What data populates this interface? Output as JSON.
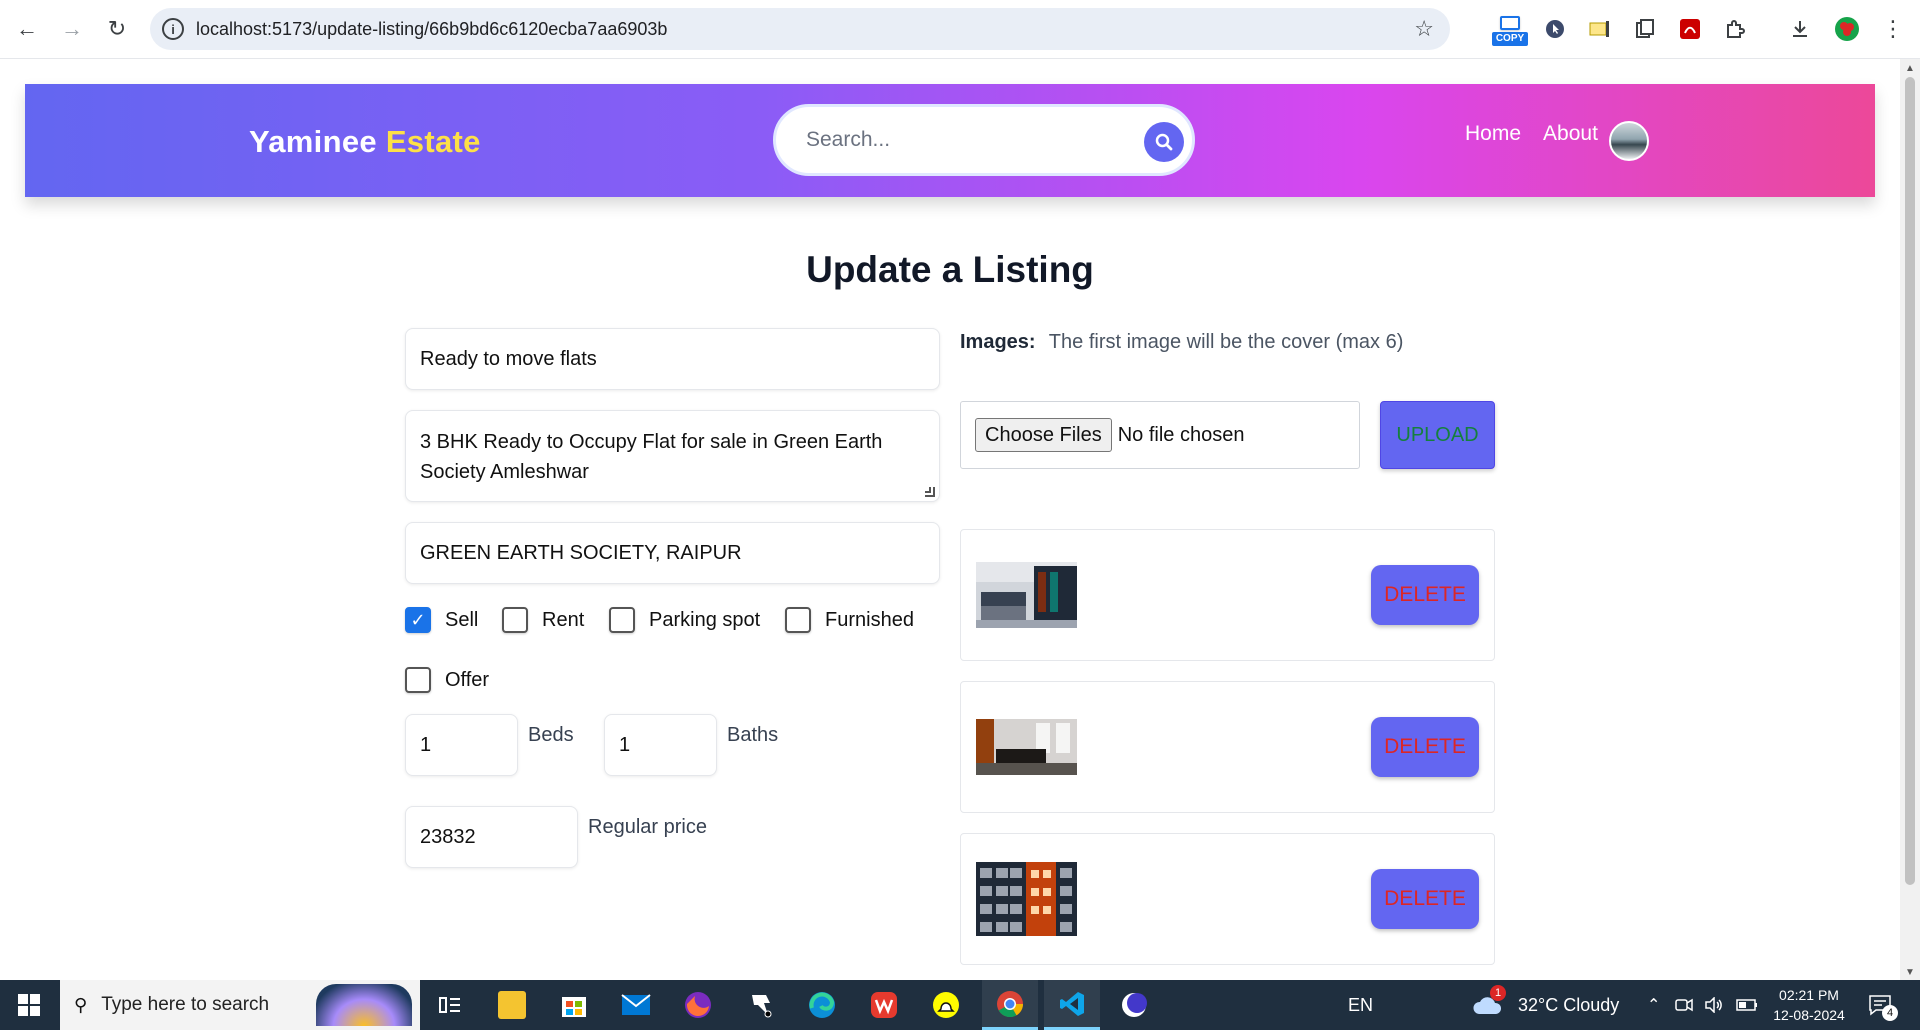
{
  "browser": {
    "url": "localhost:5173/update-listing/66b9bd6c6120ecba7aa6903b",
    "copy_label": "COPY"
  },
  "header": {
    "logo_part1": "Yaminee",
    "logo_part2": "Estate",
    "search_placeholder": "Search...",
    "nav": {
      "home": "Home",
      "about": "About"
    }
  },
  "page_title": "Update a Listing",
  "form": {
    "name": "Ready to move flats",
    "description": "3 BHK Ready to Occupy Flat for sale in Green Earth Society Amleshwar",
    "address": "GREEN EARTH SOCIETY, RAIPUR",
    "checkboxes": {
      "sell": {
        "label": "Sell",
        "checked": true
      },
      "rent": {
        "label": "Rent",
        "checked": false
      },
      "parking": {
        "label": "Parking spot",
        "checked": false
      },
      "furnished": {
        "label": "Furnished",
        "checked": false
      },
      "offer": {
        "label": "Offer",
        "checked": false
      }
    },
    "beds": {
      "value": "1",
      "label": "Beds"
    },
    "baths": {
      "value": "1",
      "label": "Baths"
    },
    "regular_price": {
      "value": "23832",
      "label": "Regular price"
    }
  },
  "images": {
    "label": "Images:",
    "hint": "The first image will be the cover (max 6)",
    "choose_files": "Choose Files",
    "no_file": "No file chosen",
    "upload": "UPLOAD",
    "delete_label": "DELETE",
    "count": 3
  },
  "taskbar": {
    "search_placeholder": "Type here to search",
    "language": "EN",
    "weather": "32°C  Cloudy",
    "weather_badge": "1",
    "time": "02:21 PM",
    "date": "12-08-2024",
    "notifications": "4"
  },
  "colors": {
    "accent": "#6366f1",
    "logo_highlight": "#fde047",
    "delete_text": "#dc2626",
    "upload_text": "#15803d"
  }
}
